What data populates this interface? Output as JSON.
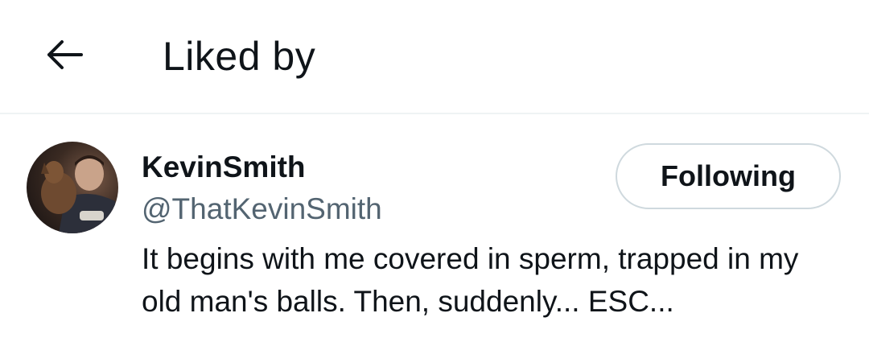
{
  "header": {
    "back_icon": "arrow-left-icon",
    "title": "Liked by"
  },
  "users": [
    {
      "display_name": "KevinSmith",
      "handle": "@ThatKevinSmith",
      "bio": "It begins with me covered in sperm, trapped in my old man's balls. Then, suddenly... ESC...",
      "follow_label": "Following",
      "avatar_icon": "profile-photo"
    }
  ],
  "colors": {
    "text_primary": "#0f1419",
    "text_secondary": "#536471",
    "border": "#cfd9de",
    "divider": "#eff3f4",
    "background": "#ffffff"
  }
}
